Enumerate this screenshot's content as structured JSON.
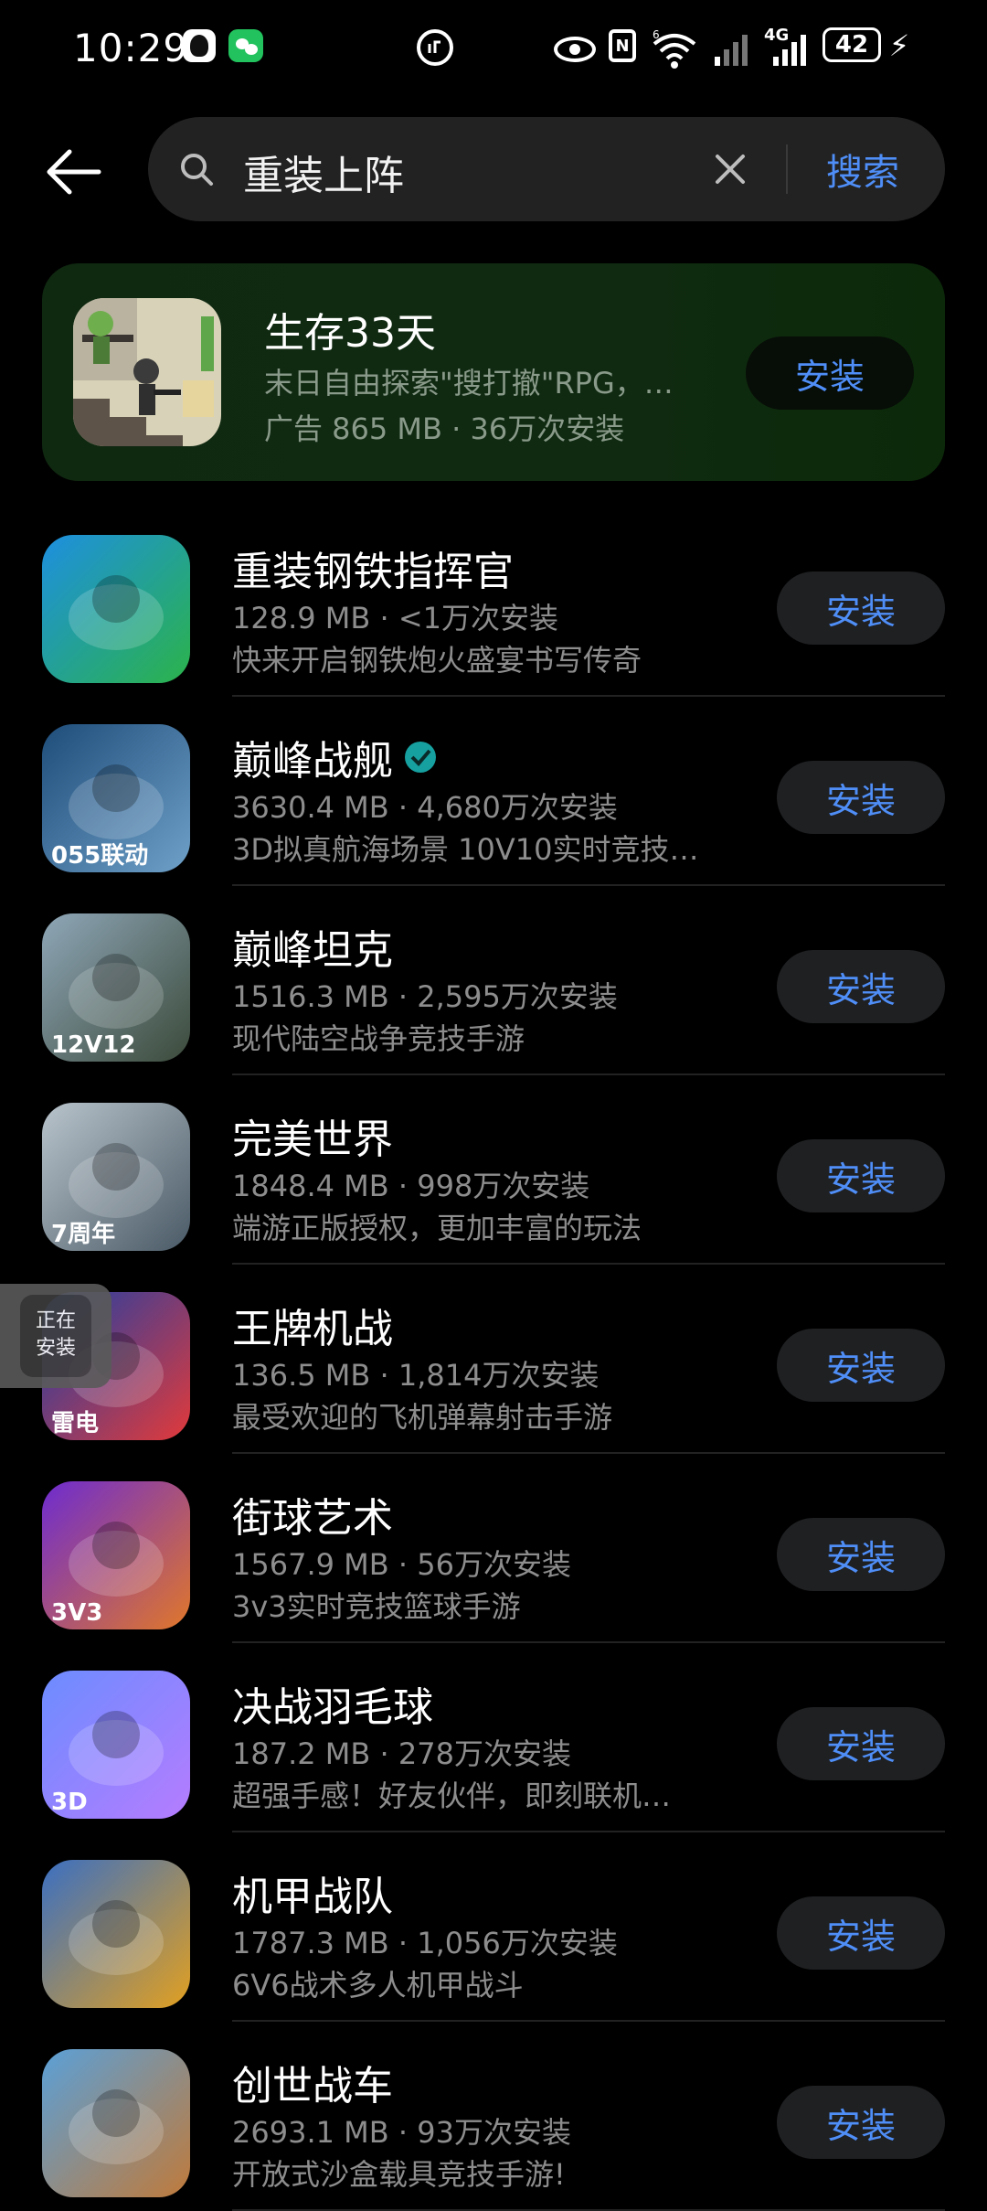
{
  "status_bar": {
    "time": "10:29",
    "network": "4G",
    "wifi_sup": "6",
    "battery": "42"
  },
  "search": {
    "value": "重装上阵",
    "button_label": "搜索"
  },
  "ad": {
    "title": "生存33天",
    "description": "末日自由探索\"搜打撤\"RPG，…",
    "meta": "广告 865 MB · 36万次安装",
    "button": "安装"
  },
  "apps": [
    {
      "name": "重装钢铁指挥官",
      "meta": "128.9 MB · <1万次安装",
      "desc": "快来开启钢铁炮火盛宴书写传奇",
      "button": "安装",
      "icon": "tank-game-icon",
      "colors": [
        "#1d8fe0",
        "#2bb34a"
      ]
    },
    {
      "name": "巅峰战舰",
      "meta": "3630.4 MB · 4,680万次安装",
      "desc": "3D拟真航海场景 10V10实时竞技…",
      "button": "安装",
      "icon": "warship-game-icon",
      "colors": [
        "#1f4d7a",
        "#6ea0c8"
      ],
      "badge": "055联动",
      "verified": true
    },
    {
      "name": "巅峰坦克",
      "meta": "1516.3 MB · 2,595万次安装",
      "desc": "现代陆空战争竞技手游",
      "button": "安装",
      "icon": "helicopter-game-icon",
      "colors": [
        "#8fa7b8",
        "#3b4a3a"
      ],
      "badge": "12V12"
    },
    {
      "name": "完美世界",
      "meta": "1848.4 MB · 998万次安装",
      "desc": "端游正版授权，更加丰富的玩法",
      "button": "安装",
      "icon": "white-tiger-game-icon",
      "colors": [
        "#b9c4cc",
        "#4a5a66"
      ],
      "badge": "7周年"
    },
    {
      "name": "王牌机战",
      "meta": "136.5 MB · 1,814万次安装",
      "desc": "最受欢迎的飞机弹幕射击手游",
      "button": "安装",
      "icon": "mecha-plane-game-icon",
      "colors": [
        "#1b3fa8",
        "#e23a3a"
      ],
      "badge": "雷电"
    },
    {
      "name": "街球艺术",
      "meta": "1567.9 MB · 56万次安装",
      "desc": "3v3实时竞技篮球手游",
      "button": "安装",
      "icon": "basketball-game-icon",
      "colors": [
        "#6d2bd0",
        "#e0772a"
      ],
      "badge": "3V3"
    },
    {
      "name": "决战羽毛球",
      "meta": "187.2 MB · 278万次安装",
      "desc": "超强手感！好友伙伴，即刻联机…",
      "button": "安装",
      "icon": "badminton-game-icon",
      "colors": [
        "#6c8cff",
        "#b57cff"
      ],
      "badge": "3D"
    },
    {
      "name": "机甲战队",
      "meta": "1787.3 MB · 1,056万次安装",
      "desc": "6V6战术多人机甲战斗",
      "button": "安装",
      "icon": "mecha-robot-game-icon",
      "colors": [
        "#3a6fc2",
        "#e2a020"
      ]
    },
    {
      "name": "创世战车",
      "meta": "2693.1 MB · 93万次安装",
      "desc": "开放式沙盒载具竞技手游!",
      "button": "安装",
      "icon": "armored-car-game-icon",
      "colors": [
        "#5aa0d8",
        "#c07a3a"
      ]
    }
  ],
  "floater": {
    "line1": "正在",
    "line2": "安装"
  },
  "theme": {
    "accent": "#4f8ef7",
    "background": "#000000",
    "button_bg": "#1f2022"
  }
}
